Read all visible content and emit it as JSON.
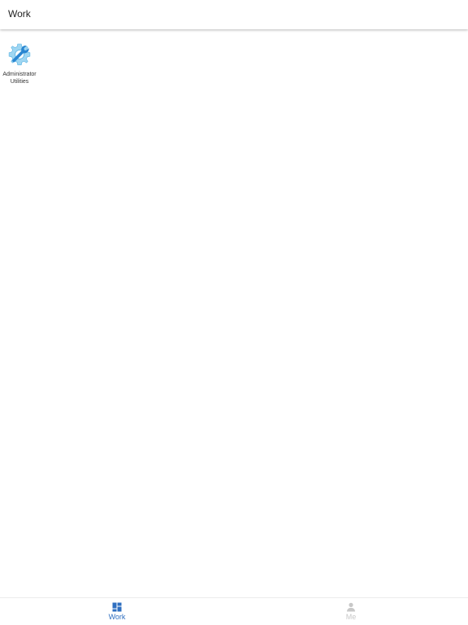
{
  "header": {
    "title": "Work"
  },
  "apps": [
    {
      "label": "Administrator\nUtilities",
      "icon": "gear-wrench-icon"
    }
  ],
  "tabs": [
    {
      "label": "Work",
      "icon": "grid-icon",
      "active": true,
      "color": "#2f6fc0"
    },
    {
      "label": "Me",
      "icon": "person-icon",
      "active": false,
      "color": "#c8c8c8"
    }
  ],
  "colors": {
    "accent": "#2f6fc0",
    "icon_blue": "#2a86d1",
    "icon_light_blue": "#9ed6f2",
    "inactive": "#c8c8c8"
  }
}
